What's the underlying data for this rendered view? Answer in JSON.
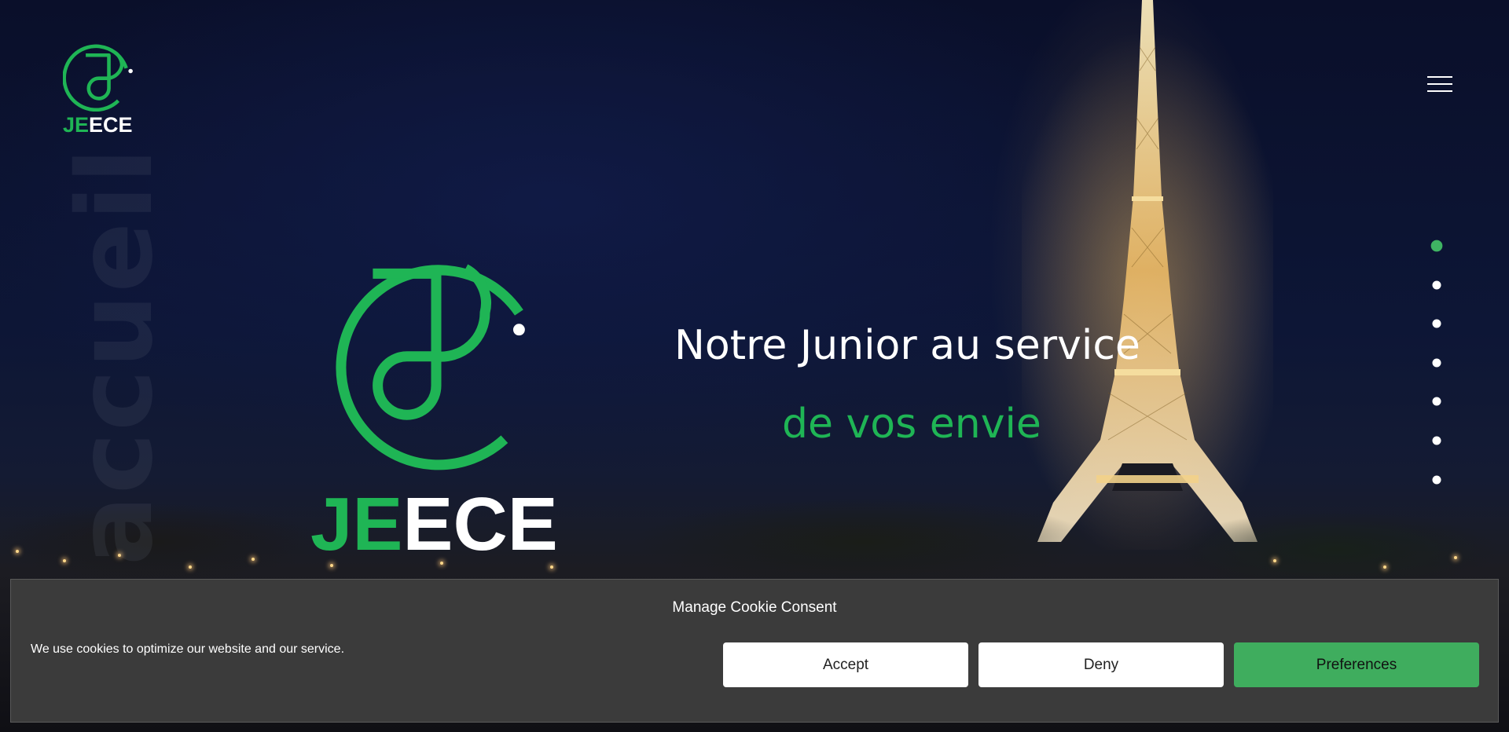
{
  "brand": {
    "logo_prefix": "JE",
    "logo_suffix": "ECE",
    "green": "#1fb555",
    "white": "#ffffff"
  },
  "watermark": "accueil",
  "hero": {
    "line1": "Notre Junior au service",
    "line2": "de vos envie"
  },
  "nav": {
    "menu_icon": "hamburger-icon",
    "section_dots": [
      {
        "active": true
      },
      {
        "active": false
      },
      {
        "active": false
      },
      {
        "active": false
      },
      {
        "active": false
      },
      {
        "active": false
      },
      {
        "active": false
      }
    ],
    "active_dot_color": "#3fb463"
  },
  "cookie": {
    "title": "Manage Cookie Consent",
    "message": "We use cookies to optimize our website and our service.",
    "accept_label": "Accept",
    "deny_label": "Deny",
    "preferences_label": "Preferences",
    "background": "#3b3b3b",
    "preferences_color": "#3fad5e"
  }
}
